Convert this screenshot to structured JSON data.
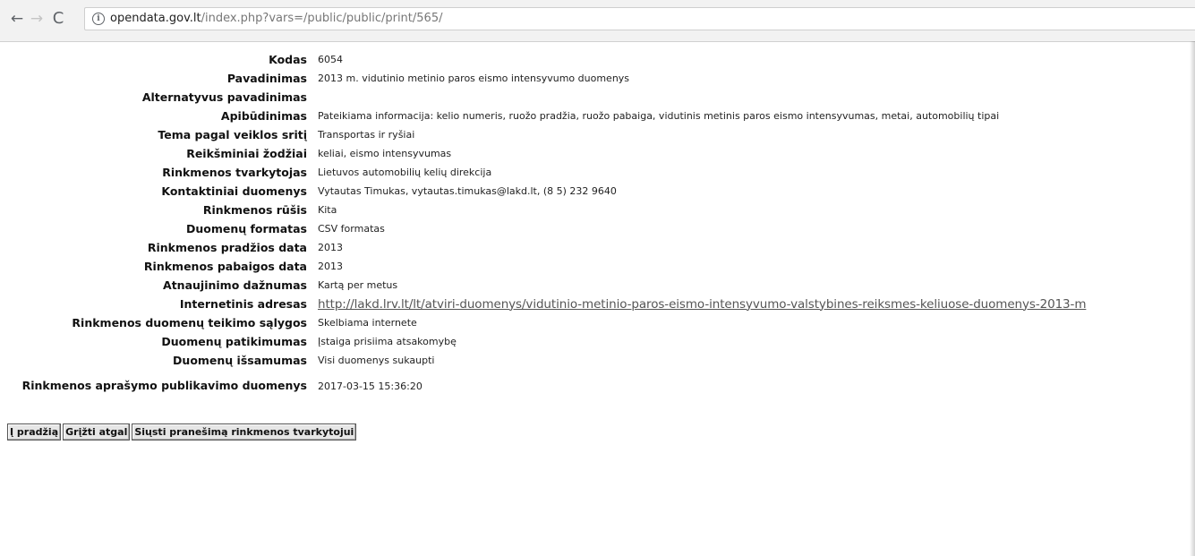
{
  "browser": {
    "url_domain": "opendata.gov.lt",
    "url_path": "/index.php?vars=/public/public/print/565/",
    "back_icon": "←",
    "forward_icon": "→",
    "reload_icon": "C",
    "info_icon": "i"
  },
  "fields": [
    {
      "label": "Kodas",
      "value": "6054"
    },
    {
      "label": "Pavadinimas",
      "value": "2013 m. vidutinio metinio paros eismo intensyvumo duomenys"
    },
    {
      "label": "Alternatyvus pavadinimas",
      "value": ""
    },
    {
      "label": "Apibūdinimas",
      "value": "Pateikiama informacija: kelio numeris, ruožo pradžia, ruožo pabaiga, vidutinis metinis paros eismo intensyvumas, metai, automobilių tipai"
    },
    {
      "label": "Tema pagal veiklos sritį",
      "value": "Transportas ir ryšiai"
    },
    {
      "label": "Reikšminiai žodžiai",
      "value": "keliai, eismo intensyvumas"
    },
    {
      "label": "Rinkmenos tvarkytojas",
      "value": "Lietuvos automobilių kelių direkcija"
    },
    {
      "label": "Kontaktiniai duomenys",
      "value": "Vytautas Timukas, vytautas.timukas@lakd.lt, (8 5) 232 9640"
    },
    {
      "label": "Rinkmenos rūšis",
      "value": "Kita"
    },
    {
      "label": "Duomenų formatas",
      "value": "CSV formatas"
    },
    {
      "label": "Rinkmenos pradžios data",
      "value": "2013"
    },
    {
      "label": "Rinkmenos pabaigos data",
      "value": "2013"
    },
    {
      "label": "Atnaujinimo dažnumas",
      "value": "Kartą per metus"
    },
    {
      "label": "Internetinis adresas",
      "value": "http://lakd.lrv.lt/lt/atviri-duomenys/vidutinio-metinio-paros-eismo-intensyvumo-valstybines-reiksmes-keliuose-duomenys-2013-m"
    },
    {
      "label": "Rinkmenos duomenų teikimo sąlygos",
      "value": "Skelbiama internete"
    },
    {
      "label": "Duomenų patikimumas",
      "value": "Įstaiga prisiima atsakomybę"
    },
    {
      "label": "Duomenų išsamumas",
      "value": "Visi duomenys sukaupti"
    },
    {
      "label": "Rinkmenos aprašymo publikavimo duomenys",
      "value": "2017-03-15 15:36:20"
    }
  ],
  "buttons": {
    "home": "Į pradžią",
    "back": "Grįžti atgal",
    "notify": "Siųsti pranešimą rinkmenos tvarkytojui"
  }
}
